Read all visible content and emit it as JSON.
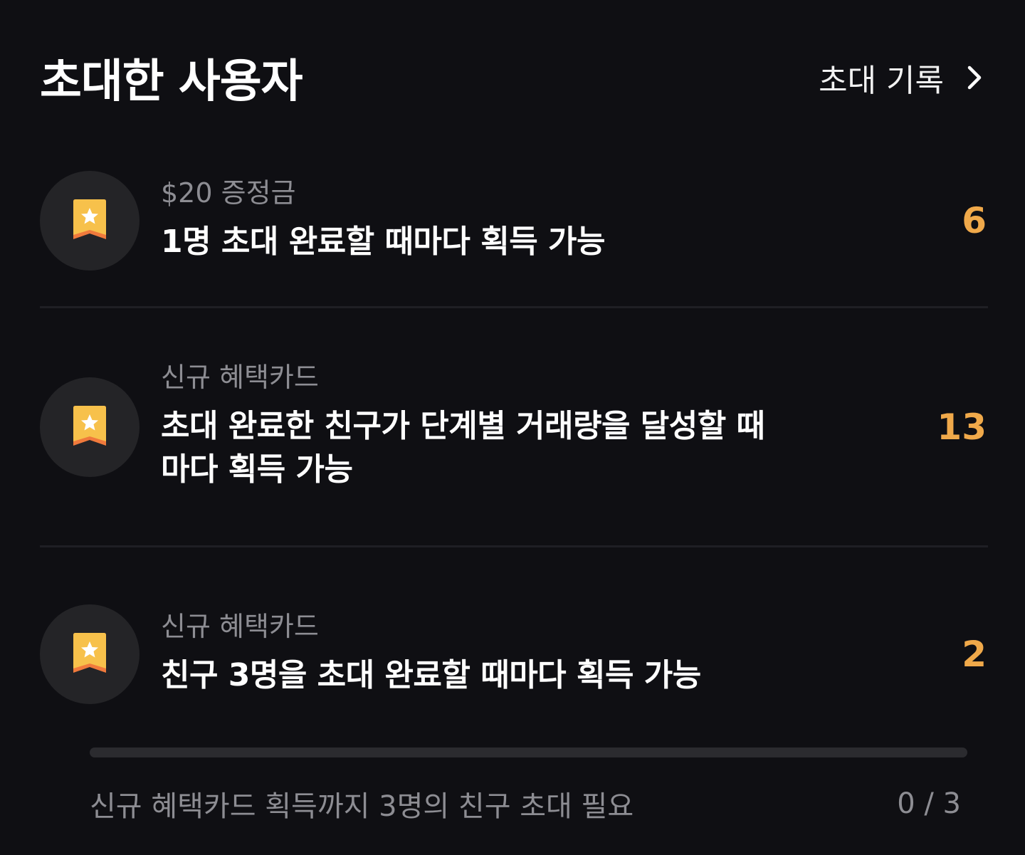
{
  "header": {
    "title": "초대한 사용자",
    "history_label": "초대 기록",
    "history_icon": "chevron-right-icon"
  },
  "rewards": [
    {
      "icon": "star-bookmark-icon",
      "label": "$20 증정금",
      "description": "1명 초대 완료할 때마다 획득 가능",
      "count": "6"
    },
    {
      "icon": "star-bookmark-icon",
      "label": "신규 혜택카드",
      "description": "초대 완료한 친구가 단계별 거래량을 달성할 때마다 획득 가능",
      "count": "13"
    },
    {
      "icon": "star-bookmark-icon",
      "label": "신규 혜택카드",
      "description": "친구 3명을 초대 완료할 때마다 획득 가능",
      "count": "2"
    }
  ],
  "progress": {
    "text": "신규 혜택카드 획득까지 3명의 친구 초대 필요",
    "value_text": "0 / 3",
    "current": 0,
    "total": 3
  },
  "colors": {
    "background": "#0f0f13",
    "accent": "#f0a94a",
    "icon_circle": "#242427",
    "muted_text": "#8d8d93"
  }
}
